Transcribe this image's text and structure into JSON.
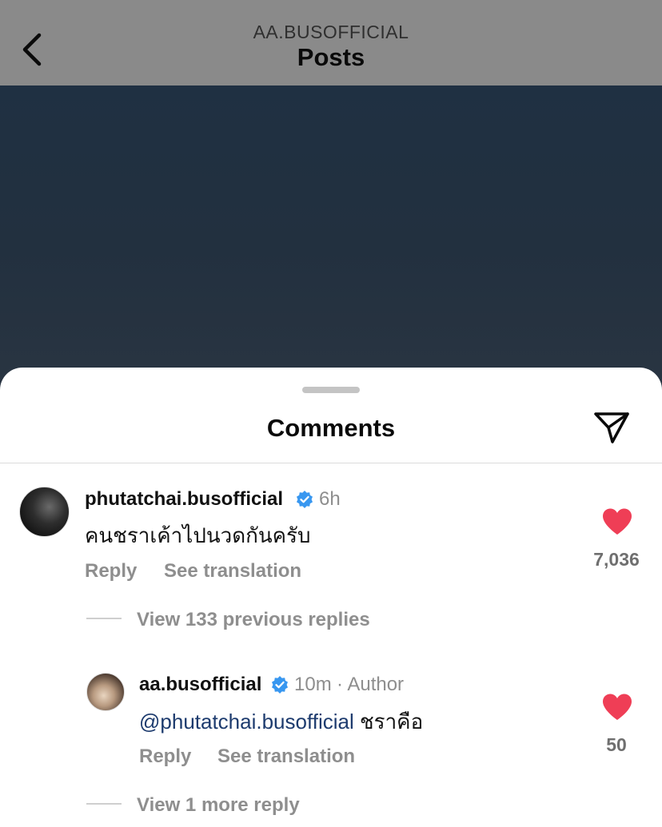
{
  "header": {
    "username": "AA.BUSOFFICIAL",
    "title": "Posts",
    "back_icon": "chevron-left-icon"
  },
  "sheet": {
    "title": "Comments",
    "share_icon": "send-icon"
  },
  "comments": [
    {
      "username": "phutatchai.busofficial",
      "verified": true,
      "time": "6h",
      "text": "คนชราเค้าไปนวดกันครับ",
      "reply_label": "Reply",
      "translate_label": "See translation",
      "likes": "7,036",
      "liked": true,
      "view_replies": "View 133 previous replies"
    },
    {
      "username": "aa.busofficial",
      "verified": true,
      "time": "10m",
      "author_tag": "· Author",
      "mention": "@phutatchai.busofficial",
      "text": " ชราคือ",
      "reply_label": "Reply",
      "translate_label": "See translation",
      "likes": "50",
      "liked": true,
      "view_replies": "View 1 more reply"
    }
  ],
  "colors": {
    "heart": "#ef3e56",
    "verified": "#3897f0",
    "mention": "#1d3b6e",
    "topbar": "#8a8a8a"
  }
}
